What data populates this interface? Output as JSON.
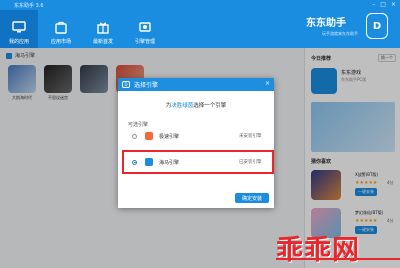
{
  "window": {
    "title": "东东助手 3.6",
    "controls": [
      "–",
      "□",
      "×"
    ]
  },
  "nav": [
    {
      "label": "我的应用",
      "icon": "monitor-icon",
      "active": true
    },
    {
      "label": "应用市场",
      "icon": "bag-icon",
      "active": false
    },
    {
      "label": "最新首发",
      "icon": "gift-icon",
      "active": false
    },
    {
      "label": "引擎管理",
      "icon": "engine-icon",
      "active": false
    }
  ],
  "brand": {
    "name": "东东助手",
    "subtitle": "玩手游就来东东助手",
    "logo": "D"
  },
  "main": {
    "section_title": "海马引擎",
    "games": [
      {
        "name": "大航海时代"
      },
      {
        "name": "不思议迷宫"
      },
      {
        "name": ""
      },
      {
        "name": ""
      }
    ]
  },
  "sidebar": {
    "today_title": "今日推荐",
    "swap_label": "换一个",
    "rec_name": "东东游戏",
    "rec_desc": "东东助手PC版",
    "hot_title": "猜你喜欢",
    "hot": [
      {
        "name": "X战警(BT版)",
        "stars": "★★★★★",
        "score": "4分",
        "button": "一键安装"
      },
      {
        "name": "梦幻诛仙(BT版)",
        "stars": "★★★★★",
        "score": "4分",
        "button": "一键安装"
      }
    ]
  },
  "dialog": {
    "title": "选择引擎",
    "prompt_pre": "为",
    "prompt_highlight": "决胜绿茵",
    "prompt_post": "选择一个引擎",
    "options_label": "可选引擎",
    "engines": [
      {
        "name": "极速引擎",
        "status": "未安装引擎",
        "selected": false
      },
      {
        "name": "海马引擎",
        "status": "已安装引擎",
        "selected": true
      }
    ],
    "confirm_label": "确定安装"
  },
  "watermark": "乖乖网"
}
